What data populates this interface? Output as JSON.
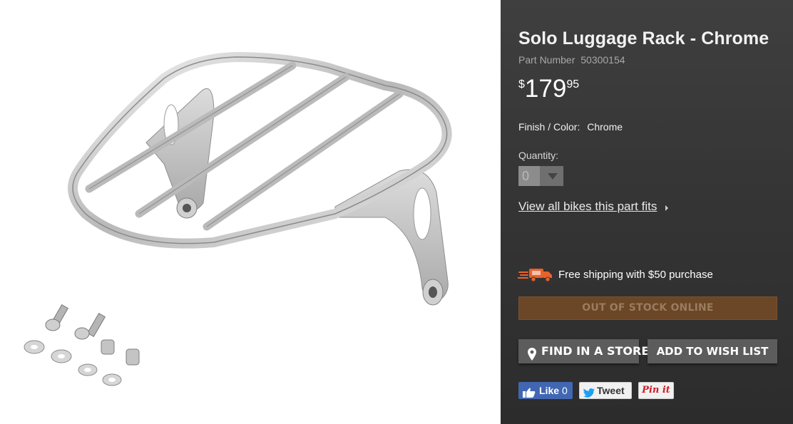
{
  "product": {
    "title": "Solo Luggage Rack - Chrome",
    "part_number_label": "Part Number",
    "part_number": "50300154",
    "price": {
      "currency": "$",
      "dollars": "179",
      "cents": "95"
    },
    "finish_label": "Finish / Color:",
    "finish_value": "Chrome",
    "image_icon": "luggage-rack-product-image"
  },
  "quantity": {
    "label": "Quantity:",
    "value": "0"
  },
  "fitment_link": "View all bikes this part fits",
  "shipping": {
    "text": "Free shipping with $50 purchase",
    "icon": "speeding-truck-icon"
  },
  "buttons": {
    "out_of_stock": "OUT OF STOCK ONLINE",
    "find_store": "FIND IN A STORE",
    "wish_list": "ADD TO WISH LIST"
  },
  "social": {
    "like_label": "Like",
    "like_count": "0",
    "tweet_label": "Tweet",
    "pin_label": "Pin it"
  },
  "colors": {
    "panel_bg": "#353535",
    "out_of_stock_bg": "#6b4627",
    "shipping_icon": "#e8622c",
    "facebook": "#4267b2"
  }
}
